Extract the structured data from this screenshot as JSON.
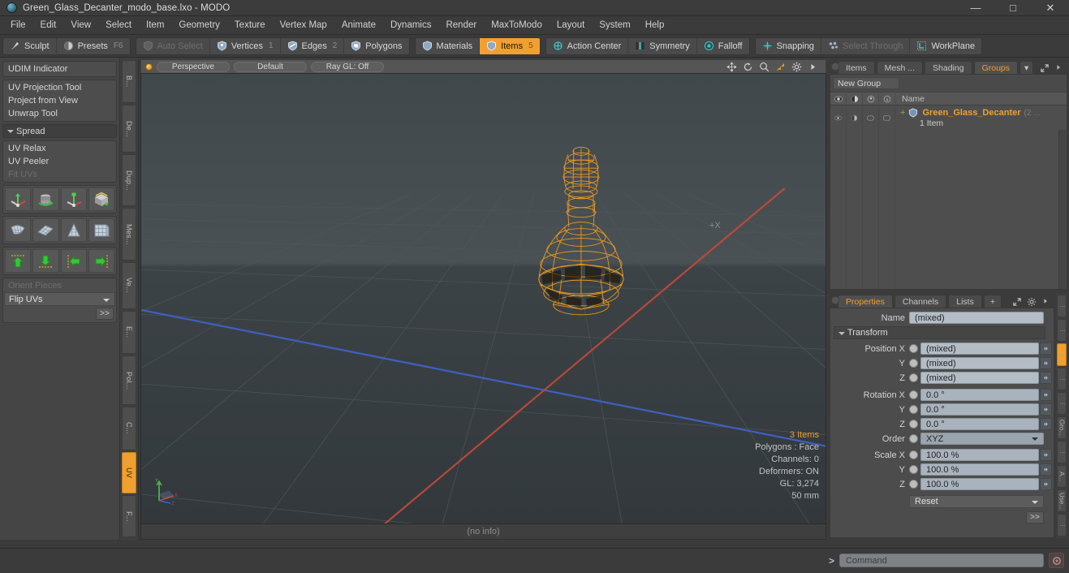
{
  "titlebar": {
    "title": "Green_Glass_Decanter_modo_base.lxo - MODO",
    "app_icon": "modo-sphere-icon",
    "minimize": "—",
    "maximize": "□",
    "close": "✕"
  },
  "menubar": {
    "items": [
      {
        "label": "File"
      },
      {
        "label": "Edit"
      },
      {
        "label": "View"
      },
      {
        "label": "Select"
      },
      {
        "label": "Item"
      },
      {
        "label": "Geometry"
      },
      {
        "label": "Texture"
      },
      {
        "label": "Vertex Map"
      },
      {
        "label": "Animate"
      },
      {
        "label": "Dynamics"
      },
      {
        "label": "Render"
      },
      {
        "label": "MaxToModo"
      },
      {
        "label": "Layout"
      },
      {
        "label": "System"
      },
      {
        "label": "Help"
      }
    ]
  },
  "modebar": {
    "groups": [
      {
        "buttons": [
          {
            "label": "Sculpt",
            "icon": "sculpt-brush-icon",
            "num": "",
            "state": "normal"
          },
          {
            "label": "Presets",
            "icon": "presets-sphere-icon",
            "num": "F6",
            "state": "normal"
          }
        ]
      },
      {
        "buttons": [
          {
            "label": "Auto Select",
            "icon": "shield-icon",
            "num": "",
            "state": "dim"
          },
          {
            "label": "Vertices",
            "icon": "vertices-icon",
            "num": "1",
            "state": "normal"
          },
          {
            "label": "Edges",
            "icon": "edges-icon",
            "num": "2",
            "state": "normal"
          },
          {
            "label": "Polygons",
            "icon": "polygons-icon",
            "num": "",
            "state": "normal"
          }
        ]
      },
      {
        "buttons": [
          {
            "label": "Materials",
            "icon": "materials-icon",
            "num": "",
            "state": "normal"
          },
          {
            "label": "Items",
            "icon": "items-icon",
            "num": "5",
            "state": "active"
          }
        ]
      },
      {
        "buttons": [
          {
            "label": "Action Center",
            "icon": "action-center-icon",
            "num": "",
            "state": "normal"
          },
          {
            "label": "Symmetry",
            "icon": "symmetry-icon",
            "num": "",
            "state": "normal"
          },
          {
            "label": "Falloff",
            "icon": "falloff-icon",
            "num": "",
            "state": "normal"
          }
        ]
      },
      {
        "buttons": [
          {
            "label": "Snapping",
            "icon": "snapping-icon",
            "num": "",
            "state": "normal"
          },
          {
            "label": "Select Through",
            "icon": "select-through-icon",
            "num": "",
            "state": "dim"
          },
          {
            "label": "WorkPlane",
            "icon": "workplane-icon",
            "num": "",
            "state": "normal"
          }
        ]
      }
    ]
  },
  "leftpanel": {
    "udim": "UDIM Indicator",
    "tools_group1": [
      {
        "label": "UV Projection Tool",
        "state": "normal"
      },
      {
        "label": "Project from View",
        "state": "normal"
      },
      {
        "label": "Unwrap Tool",
        "state": "normal"
      }
    ],
    "spread_header": "Spread",
    "tools_group2": [
      {
        "label": "UV Relax",
        "state": "normal"
      },
      {
        "label": "UV Peeler",
        "state": "normal"
      },
      {
        "label": "Fit UVs",
        "state": "dim"
      }
    ],
    "icon_row1": [
      "uv-move-gizmo-icon",
      "uv-rotate-cylinder-icon",
      "uv-scale-gizmo-icon",
      "uv-box-unwrap-icon"
    ],
    "icon_row2": [
      "uv-mesh-deform-icon",
      "uv-grid-flat-icon",
      "uv-grid-taper-icon",
      "uv-grid-cube-icon"
    ],
    "icon_row3": [
      "align-up-icon",
      "align-down-icon",
      "align-left-icon",
      "align-right-icon"
    ],
    "orient_label": "Orient Pieces",
    "flip_uvs": "Flip UVs",
    "more_button": ">>"
  },
  "left_vtabs": [
    {
      "label": "B...",
      "active": false
    },
    {
      "label": "De...",
      "active": false
    },
    {
      "label": "Dup...",
      "active": false
    },
    {
      "label": "Mes...",
      "active": false
    },
    {
      "label": "Ve...",
      "active": false
    },
    {
      "label": "E...",
      "active": false
    },
    {
      "label": "Pol...",
      "active": false
    },
    {
      "label": "C...",
      "active": false
    },
    {
      "label": "UV",
      "active": true
    },
    {
      "label": "F...",
      "active": false
    }
  ],
  "viewport": {
    "view_mode": "Perspective",
    "shading": "Default",
    "raygl": "Ray GL: Off",
    "icons": [
      "pan-icon",
      "rotate-icon",
      "zoom-magnifier-icon",
      "fit-view-icon",
      "gear-icon",
      "chevron-right-icon"
    ],
    "axis_label_plus_x": "+X",
    "stats": [
      "3 Items",
      "Polygons : Face",
      "Channels: 0",
      "Deformers: ON",
      "GL: 3,274",
      "50 mm"
    ],
    "axis_gizmo": {
      "y": "Y",
      "x": "X",
      "z": "Z"
    },
    "footer": "(no info)"
  },
  "rightpanel": {
    "tabs": [
      {
        "label": "Items",
        "active": false
      },
      {
        "label": "Mesh ...",
        "active": false
      },
      {
        "label": "Shading",
        "active": false
      },
      {
        "label": "Groups",
        "active": true
      },
      {
        "label": "▾",
        "active": false
      }
    ],
    "tab_tools": [
      "expand-icon",
      "chevron-right-icon"
    ],
    "new_group_button": "New Group",
    "tree_header_icons": [
      "eye-icon",
      "shade-icon",
      "render-icon",
      "info-icon"
    ],
    "tree_header_name": "Name",
    "tree_row": {
      "icon": "mesh-item-icon",
      "name": "Green_Glass_Decanter",
      "count": "(2 ...",
      "subtext": "1 Item"
    }
  },
  "properties": {
    "tabs": [
      {
        "label": "Properties",
        "active": true
      },
      {
        "label": "Channels",
        "active": false
      },
      {
        "label": "Lists",
        "active": false
      },
      {
        "label": "+",
        "active": false
      }
    ],
    "tab_tools": [
      "expand-icon",
      "gear-icon",
      "chevron-right-icon"
    ],
    "name_label": "Name",
    "name_value": "(mixed)",
    "section_transform": "Transform",
    "fields": [
      {
        "label": "Position X",
        "value": "(mixed)"
      },
      {
        "label": "Y",
        "value": "(mixed)"
      },
      {
        "label": "Z",
        "value": "(mixed)"
      },
      {
        "label": "Rotation X",
        "value": "0.0 °"
      },
      {
        "label": "Y",
        "value": "0.0 °"
      },
      {
        "label": "Z",
        "value": "0.0 °"
      }
    ],
    "order_label": "Order",
    "order_value": "XYZ",
    "scale_fields": [
      {
        "label": "Scale X",
        "value": "100.0 %"
      },
      {
        "label": "Y",
        "value": "100.0 %"
      },
      {
        "label": "Z",
        "value": "100.0 %"
      }
    ],
    "reset_value": "Reset",
    "more_button": ">>"
  },
  "right_vtabs": [
    {
      "label": "⋮",
      "active": false
    },
    {
      "label": "⋮",
      "active": false
    },
    {
      "label": "⋮",
      "active": true
    },
    {
      "label": "⋮",
      "active": false
    },
    {
      "label": "⋮",
      "active": false
    },
    {
      "label": "Gro...",
      "active": false
    },
    {
      "label": "⋮",
      "active": false
    },
    {
      "label": "A...",
      "active": false
    },
    {
      "label": "Use...",
      "active": false
    },
    {
      "label": "⋮",
      "active": false
    }
  ],
  "bottombar": {
    "prompt": "&gt;",
    "command_placeholder": "Command",
    "record_icon": "record-icon"
  },
  "colors": {
    "accent_orange": "#f0a030",
    "panel_bg": "#4a4a4a",
    "window_bg": "#3b3b3b",
    "field_blue": "#a9b3bd",
    "wireframe_orange": "#f59f18",
    "axis_red": "#b84a3a",
    "axis_blue": "#3a5fb8"
  }
}
